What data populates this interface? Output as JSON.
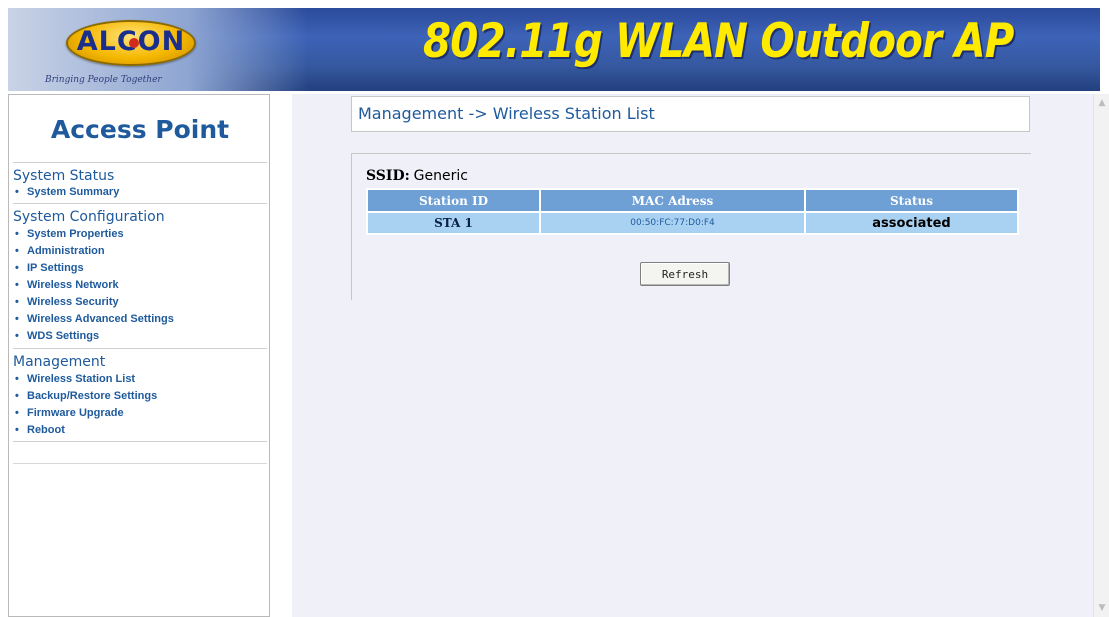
{
  "header": {
    "logo_text": "ALCON",
    "tagline": "Bringing People Together",
    "product_title": "802.11g WLAN Outdoor AP",
    "colors": {
      "title": "#ffea00",
      "banner": "#3d63b8"
    }
  },
  "sidebar": {
    "title": "Access Point",
    "sections": [
      {
        "heading": "System Status",
        "items": [
          "System Summary"
        ]
      },
      {
        "heading": "System Configuration",
        "items": [
          "System Properties",
          "Administration",
          "IP Settings",
          "Wireless Network",
          "Wireless Security",
          "Wireless Advanced Settings",
          "WDS Settings"
        ]
      },
      {
        "heading": "Management",
        "items": [
          "Wireless Station List",
          "Backup/Restore Settings",
          "Firmware Upgrade",
          "Reboot"
        ]
      }
    ],
    "bullet": "•",
    "link_color": "#1e5a9c"
  },
  "main": {
    "breadcrumb": "Management -> Wireless Station List",
    "ssid_label": "SSID:",
    "ssid_value": "Generic",
    "table": {
      "headers": [
        "Station ID",
        "MAC Adress",
        "Status"
      ],
      "rows": [
        [
          "STA 1",
          "00:50:FC:77:D0:F4",
          "associated"
        ]
      ]
    },
    "refresh_label": "Refresh"
  },
  "scrollbar": {
    "up_icon": "scroll-up-arrow-icon",
    "down_icon": "scroll-down-arrow-icon"
  }
}
